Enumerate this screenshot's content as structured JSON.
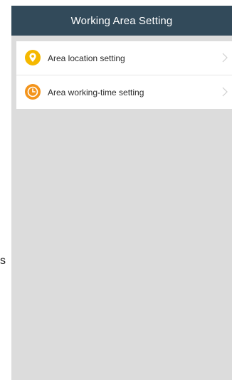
{
  "header": {
    "title": "Working Area Setting"
  },
  "menu": {
    "items": [
      {
        "label": "Area location setting",
        "icon": "location-pin-icon"
      },
      {
        "label": "Area working-time setting",
        "icon": "clock-icon"
      }
    ]
  },
  "edge_text": "s",
  "colors": {
    "nav_bar": "#324a5a",
    "background": "#dcdcdc",
    "icon_yellow": "#f5b800",
    "icon_orange": "#f3941c"
  }
}
